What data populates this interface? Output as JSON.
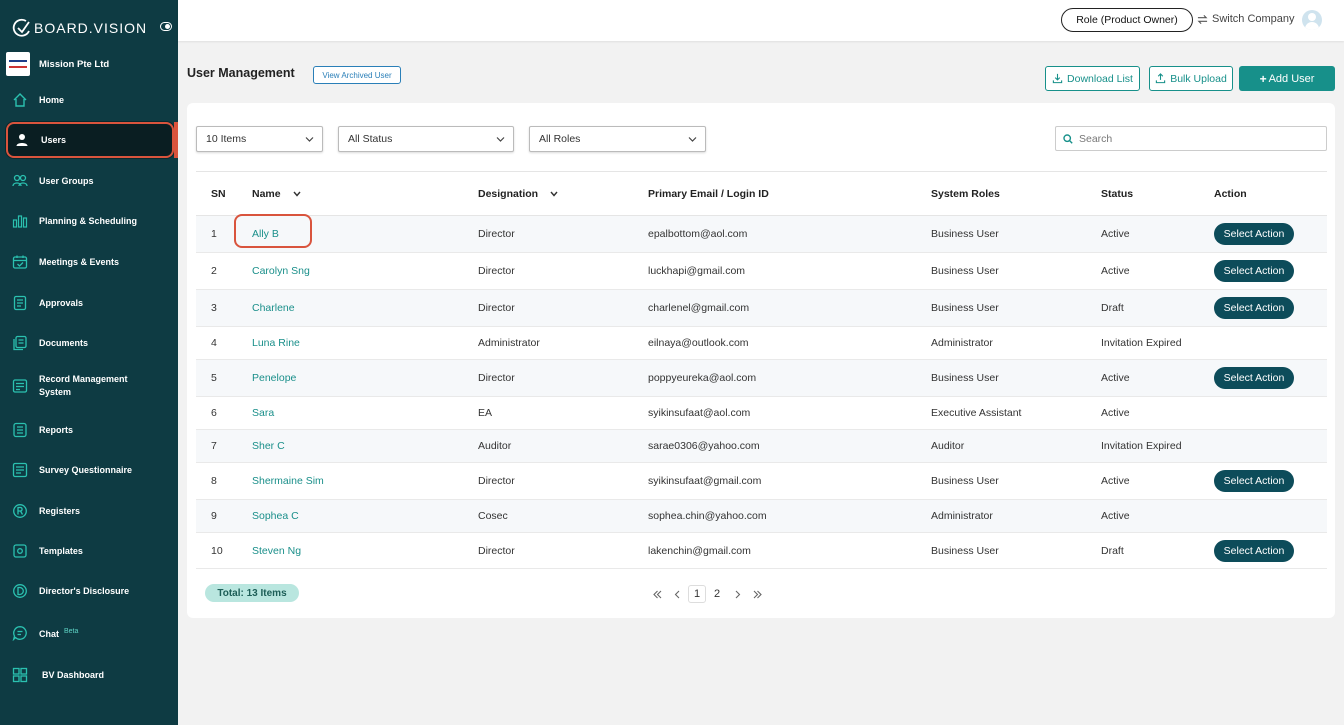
{
  "brand": {
    "name": "BOARD.VISION"
  },
  "company": {
    "name": "Mission Pte Ltd"
  },
  "nav": [
    {
      "label": "Home",
      "icon": "home-icon"
    },
    {
      "label": "Users",
      "icon": "user-icon",
      "active": true
    },
    {
      "label": "User Groups",
      "icon": "user-groups-icon"
    },
    {
      "label": "Planning & Scheduling",
      "icon": "chart-icon"
    },
    {
      "label": "Meetings & Events",
      "icon": "calendar-icon"
    },
    {
      "label": "Approvals",
      "icon": "document-icon"
    },
    {
      "label": "Documents",
      "icon": "documents-icon"
    },
    {
      "label": "Record Management",
      "label2": "System",
      "icon": "records-icon"
    },
    {
      "label": "Reports",
      "icon": "reports-icon"
    },
    {
      "label": "Survey Questionnaire",
      "icon": "survey-icon"
    },
    {
      "label": "Registers",
      "icon": "registered-icon"
    },
    {
      "label": "Templates",
      "icon": "templates-icon"
    },
    {
      "label": "Director's Disclosure",
      "icon": "disclosure-icon"
    },
    {
      "label": "Chat",
      "badge": "Beta",
      "icon": "chat-icon"
    },
    {
      "label": "BV Dashboard",
      "icon": "dashboard-icon"
    }
  ],
  "topbar": {
    "role": "Role (Product Owner)",
    "switch_company": "Switch Company"
  },
  "header": {
    "title": "User Management",
    "archived": "View Archived User",
    "download": "Download List",
    "bulk": "Bulk Upload",
    "add": "Add User"
  },
  "filters": {
    "items": "10 Items",
    "status": "All Status",
    "roles": "All Roles",
    "search_placeholder": "Search"
  },
  "table": {
    "headers": {
      "sn": "SN",
      "name": "Name",
      "designation": "Designation",
      "email": "Primary Email / Login ID",
      "roles": "System Roles",
      "status": "Status",
      "action": "Action"
    },
    "action_label": "Select Action",
    "rows": [
      {
        "sn": "1",
        "name": "Ally B",
        "designation": "Director",
        "email": "epalbottom@aol.com",
        "role": "Business User",
        "status": "Active",
        "action": true
      },
      {
        "sn": "2",
        "name": "Carolyn Sng",
        "designation": "Director",
        "email": "luckhapi@gmail.com",
        "role": "Business User",
        "status": "Active",
        "action": true
      },
      {
        "sn": "3",
        "name": "Charlene",
        "designation": "Director",
        "email": "charlenel@gmail.com",
        "role": "Business User",
        "status": "Draft",
        "action": true
      },
      {
        "sn": "4",
        "name": "Luna Rine",
        "designation": "Administrator",
        "email": "eilnaya@outlook.com",
        "role": "Administrator",
        "status": "Invitation Expired",
        "action": false
      },
      {
        "sn": "5",
        "name": "Penelope",
        "designation": "Director",
        "email": "poppyeureka@aol.com",
        "role": "Business User",
        "status": "Active",
        "action": true
      },
      {
        "sn": "6",
        "name": "Sara",
        "designation": "EA",
        "email": "syikinsufaat@aol.com",
        "role": "Executive Assistant",
        "status": "Active",
        "action": false
      },
      {
        "sn": "7",
        "name": "Sher C",
        "designation": "Auditor",
        "email": "sarae0306@yahoo.com",
        "role": "Auditor",
        "status": "Invitation Expired",
        "action": false
      },
      {
        "sn": "8",
        "name": "Shermaine Sim",
        "designation": "Director",
        "email": "syikinsufaat@gmail.com",
        "role": "Business User",
        "status": "Active",
        "action": true
      },
      {
        "sn": "9",
        "name": "Sophea C",
        "designation": "Cosec",
        "email": "sophea.chin@yahoo.com",
        "role": "Administrator",
        "status": "Active",
        "action": false
      },
      {
        "sn": "10",
        "name": "Steven Ng",
        "designation": "Director",
        "email": "lakenchin@gmail.com",
        "role": "Business User",
        "status": "Draft",
        "action": true
      }
    ]
  },
  "footer": {
    "total": "Total: 13 Items",
    "pages": [
      "1",
      "2"
    ],
    "current_page": "1"
  },
  "colors": {
    "sidebar": "#0e3b43",
    "accent": "#17908a",
    "highlight": "#d9543d",
    "action_button": "#0d4c5a"
  }
}
